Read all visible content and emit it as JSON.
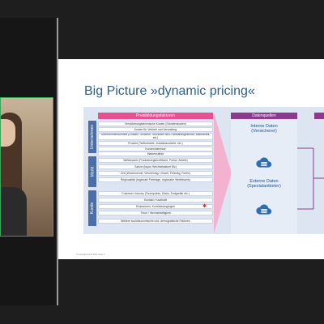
{
  "slide": {
    "title": "Big Picture »dynamic pricing«",
    "factors_header": "Preisbildungsfaktoren",
    "sources_header": "Datenquellen",
    "groups": [
      {
        "label": "Unternehmen",
        "rows": [
          "Versicherungstechnische Kosten (Schadenkosten)",
          "Kosten für Vertrieb und Verwaltung",
          "Unternehmensumfeld (Umsatz, Gewinne, Stückzahl Neu-/ Bestandsgeschäft, Marktanteil, etc.)",
          "Produkt (Tarifvariante, Zusatzbausteine, etc.)",
          "Kundeninteresse",
          "Markenstärke"
        ]
      },
      {
        "label": "Markt",
        "rows": [
          "Wettbewerb (Produktvergleich/Markt, Preise, Anteile)",
          "Saison (bspw. Wechselsaison Kfz)",
          "Zeit (Wochenende, Wochentag, Uhrzeit, Feiertag, Ferien)",
          "Regionalität (regionale Feiertage, regionaler Wettbewerb)"
        ]
      },
      {
        "label": "Kunde",
        "rows": [
          "Customer Journey (Touchpoints, Klicks, Endgeräte etc.)",
          "Kontakt / Kaufkraft",
          "Einkommen, Kontobewegungen",
          "Treue / Wechselwilligkeit",
          "Weitere sozioökonomische und -demografische Faktoren"
        ]
      }
    ],
    "sources": [
      {
        "line1": "Interne Daten",
        "line2": "(Versicherer)"
      },
      {
        "line1": "Externe Daten",
        "line2": "(Spezialanbieter)"
      }
    ],
    "footer": "© Copyright     04.03.2021     Seite 3"
  },
  "colors": {
    "title": "#2c5f8a",
    "pink": "#e8508f",
    "purple": "#8b3a8e",
    "tab_blue": "#4b6ea8",
    "content_bg": "#dde5f2",
    "cloud": "#2f6db3"
  }
}
